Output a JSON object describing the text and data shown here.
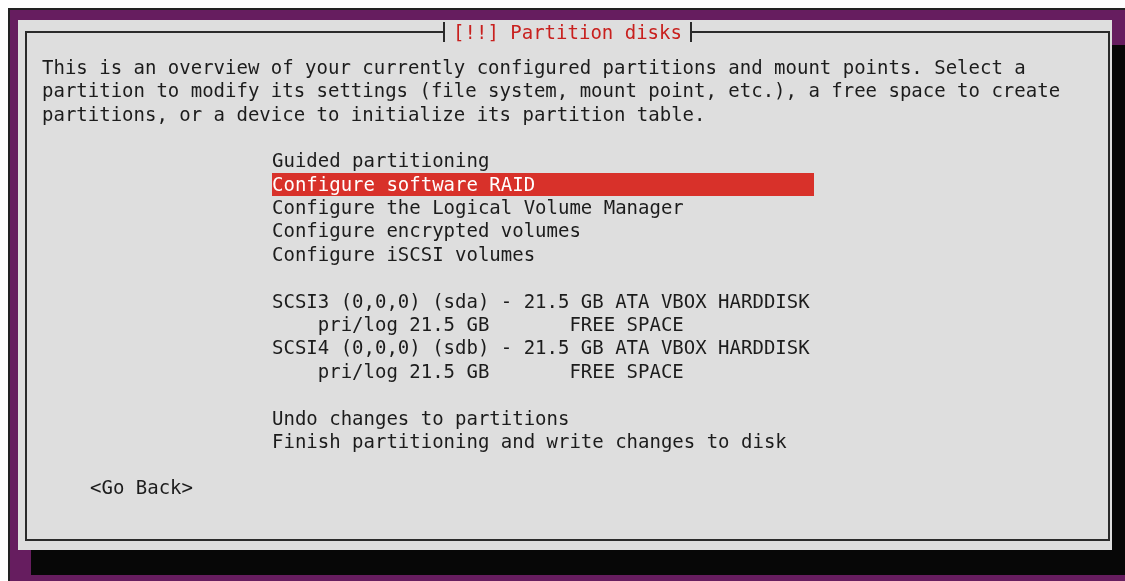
{
  "dialog": {
    "title": "[!!] Partition disks",
    "description": "This is an overview of your currently configured partitions and mount points. Select a partition to modify its settings (file system, mount point, etc.), a free space to create partitions, or a device to initialize its partition table.",
    "groups": [
      [
        {
          "kind": "action",
          "label": "Guided partitioning",
          "selected": false
        },
        {
          "kind": "action",
          "label": "Configure software RAID",
          "selected": true
        },
        {
          "kind": "action",
          "label": "Configure the Logical Volume Manager",
          "selected": false
        },
        {
          "kind": "action",
          "label": "Configure encrypted volumes",
          "selected": false
        },
        {
          "kind": "action",
          "label": "Configure iSCSI volumes",
          "selected": false
        }
      ],
      [
        {
          "kind": "disk",
          "label": "SCSI3 (0,0,0) (sda) - 21.5 GB ATA VBOX HARDDISK",
          "selected": false
        },
        {
          "kind": "partition",
          "type": "pri/log",
          "size": "21.5 GB",
          "usage": "FREE SPACE",
          "selected": false
        },
        {
          "kind": "disk",
          "label": "SCSI4 (0,0,0) (sdb) - 21.5 GB ATA VBOX HARDDISK",
          "selected": false
        },
        {
          "kind": "partition",
          "type": "pri/log",
          "size": "21.5 GB",
          "usage": "FREE SPACE",
          "selected": false
        }
      ],
      [
        {
          "kind": "action",
          "label": "Undo changes to partitions",
          "selected": false
        },
        {
          "kind": "action",
          "label": "Finish partitioning and write changes to disk",
          "selected": false
        }
      ]
    ],
    "back_button": "<Go Back>"
  }
}
